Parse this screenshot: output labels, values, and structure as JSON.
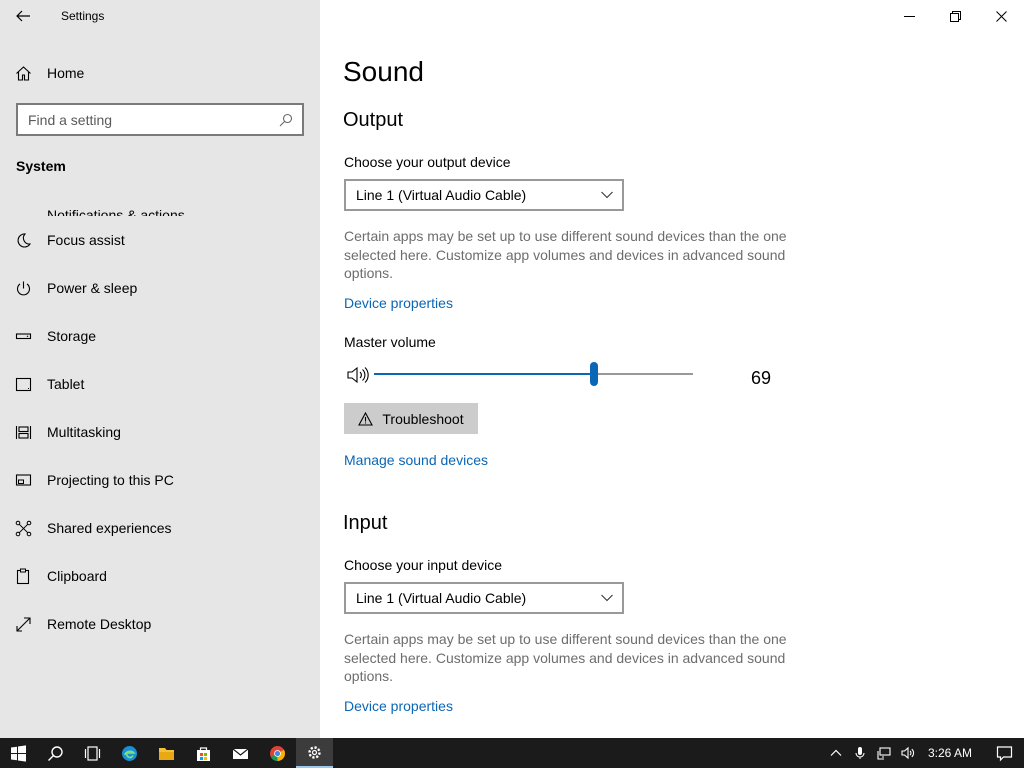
{
  "window": {
    "title": "Settings"
  },
  "sidebar": {
    "home_label": "Home",
    "search_placeholder": "Find a setting",
    "section": "System",
    "items": [
      {
        "label": "Notifications & actions",
        "icon": "notifications-icon"
      },
      {
        "label": "Focus assist",
        "icon": "moon-icon"
      },
      {
        "label": "Power & sleep",
        "icon": "power-icon"
      },
      {
        "label": "Storage",
        "icon": "storage-icon"
      },
      {
        "label": "Tablet",
        "icon": "tablet-icon"
      },
      {
        "label": "Multitasking",
        "icon": "multitasking-icon"
      },
      {
        "label": "Projecting to this PC",
        "icon": "projecting-icon"
      },
      {
        "label": "Shared experiences",
        "icon": "shared-experiences-icon"
      },
      {
        "label": "Clipboard",
        "icon": "clipboard-icon"
      },
      {
        "label": "Remote Desktop",
        "icon": "remote-desktop-icon"
      }
    ]
  },
  "main": {
    "title": "Sound",
    "output": {
      "heading": "Output",
      "device_label": "Choose your output device",
      "device_value": "Line 1 (Virtual Audio Cable)",
      "note": "Certain apps may be set up to use different sound devices than the one selected here. Customize app volumes and devices in advanced sound options.",
      "device_properties": "Device properties",
      "volume_label": "Master volume",
      "volume_value": "69",
      "volume_percent": 69,
      "troubleshoot": "Troubleshoot",
      "manage": "Manage sound devices"
    },
    "input": {
      "heading": "Input",
      "device_label": "Choose your input device",
      "device_value": "Line 1 (Virtual Audio Cable)",
      "note": "Certain apps may be set up to use different sound devices than the one selected here. Customize app volumes and devices in advanced sound options.",
      "device_properties": "Device properties"
    }
  },
  "taskbar": {
    "clock": "3:26 AM",
    "apps": [
      "start-icon",
      "search-icon",
      "task-view-icon",
      "edge-icon",
      "file-explorer-icon",
      "store-icon",
      "mail-icon",
      "chrome-icon",
      "settings-icon"
    ]
  },
  "colors": {
    "accent": "#0b66b5",
    "sidebar_bg": "#e6e6e6",
    "taskbar_bg": "#1b1b1b"
  }
}
